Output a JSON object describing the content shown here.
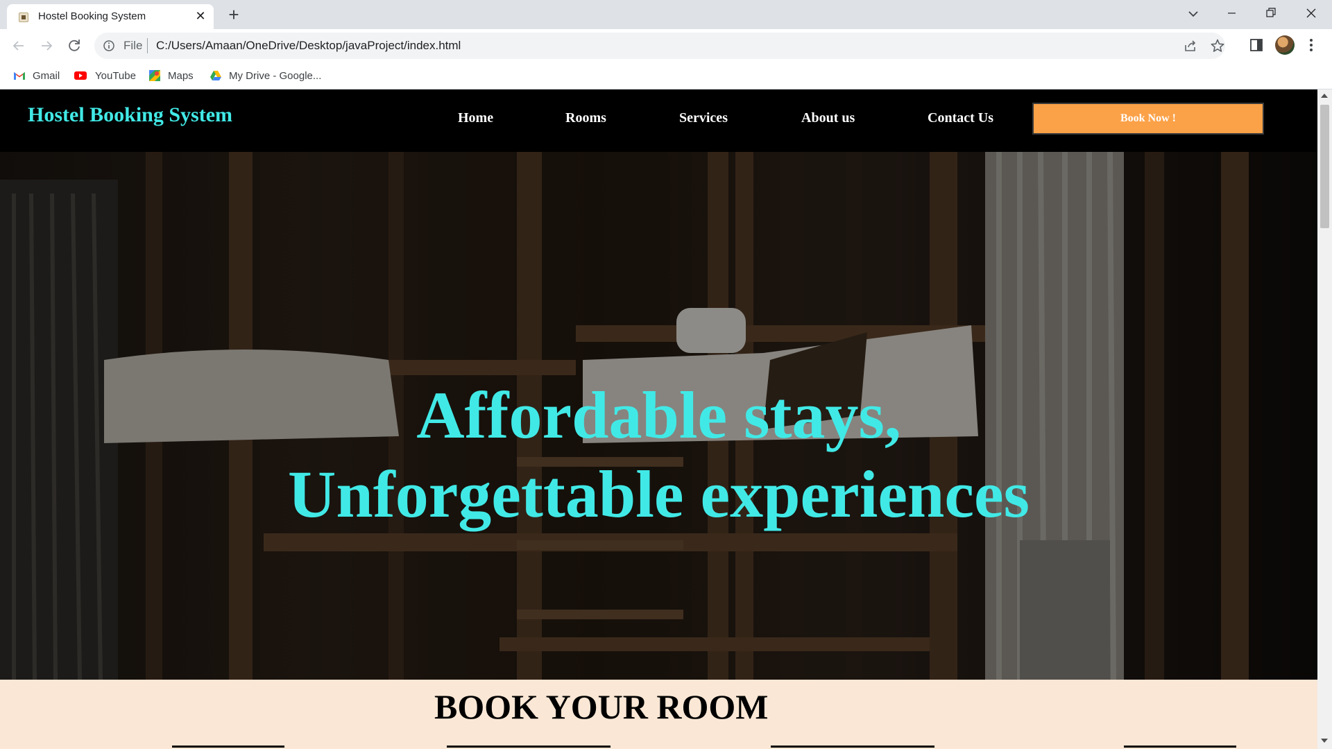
{
  "browser": {
    "tab_title": "Hostel Booking System",
    "omnibox": {
      "scheme_label": "File",
      "url": "C:/Users/Amaan/OneDrive/Desktop/javaProject/index.html"
    },
    "bookmarks": [
      {
        "label": "Gmail",
        "icon": "gmail-icon"
      },
      {
        "label": "YouTube",
        "icon": "youtube-icon"
      },
      {
        "label": "Maps",
        "icon": "maps-icon"
      },
      {
        "label": "My Drive - Google...",
        "icon": "google-drive-icon"
      }
    ]
  },
  "site": {
    "brand": "Hostel Booking System",
    "nav": [
      {
        "label": "Home"
      },
      {
        "label": "Rooms"
      },
      {
        "label": "Services"
      },
      {
        "label": "About us"
      },
      {
        "label": "Contact Us"
      }
    ],
    "cta_label": "Book Now !",
    "hero": {
      "line1": "Affordable stays,",
      "line2": "Unforgettable experiences"
    },
    "book_section": {
      "title": "BOOK YOUR ROOM"
    }
  },
  "colors": {
    "brand_accent": "#41e9e6",
    "cta_background": "#fba147",
    "nav_background": "#000000",
    "book_section_background": "#fae7d5"
  }
}
